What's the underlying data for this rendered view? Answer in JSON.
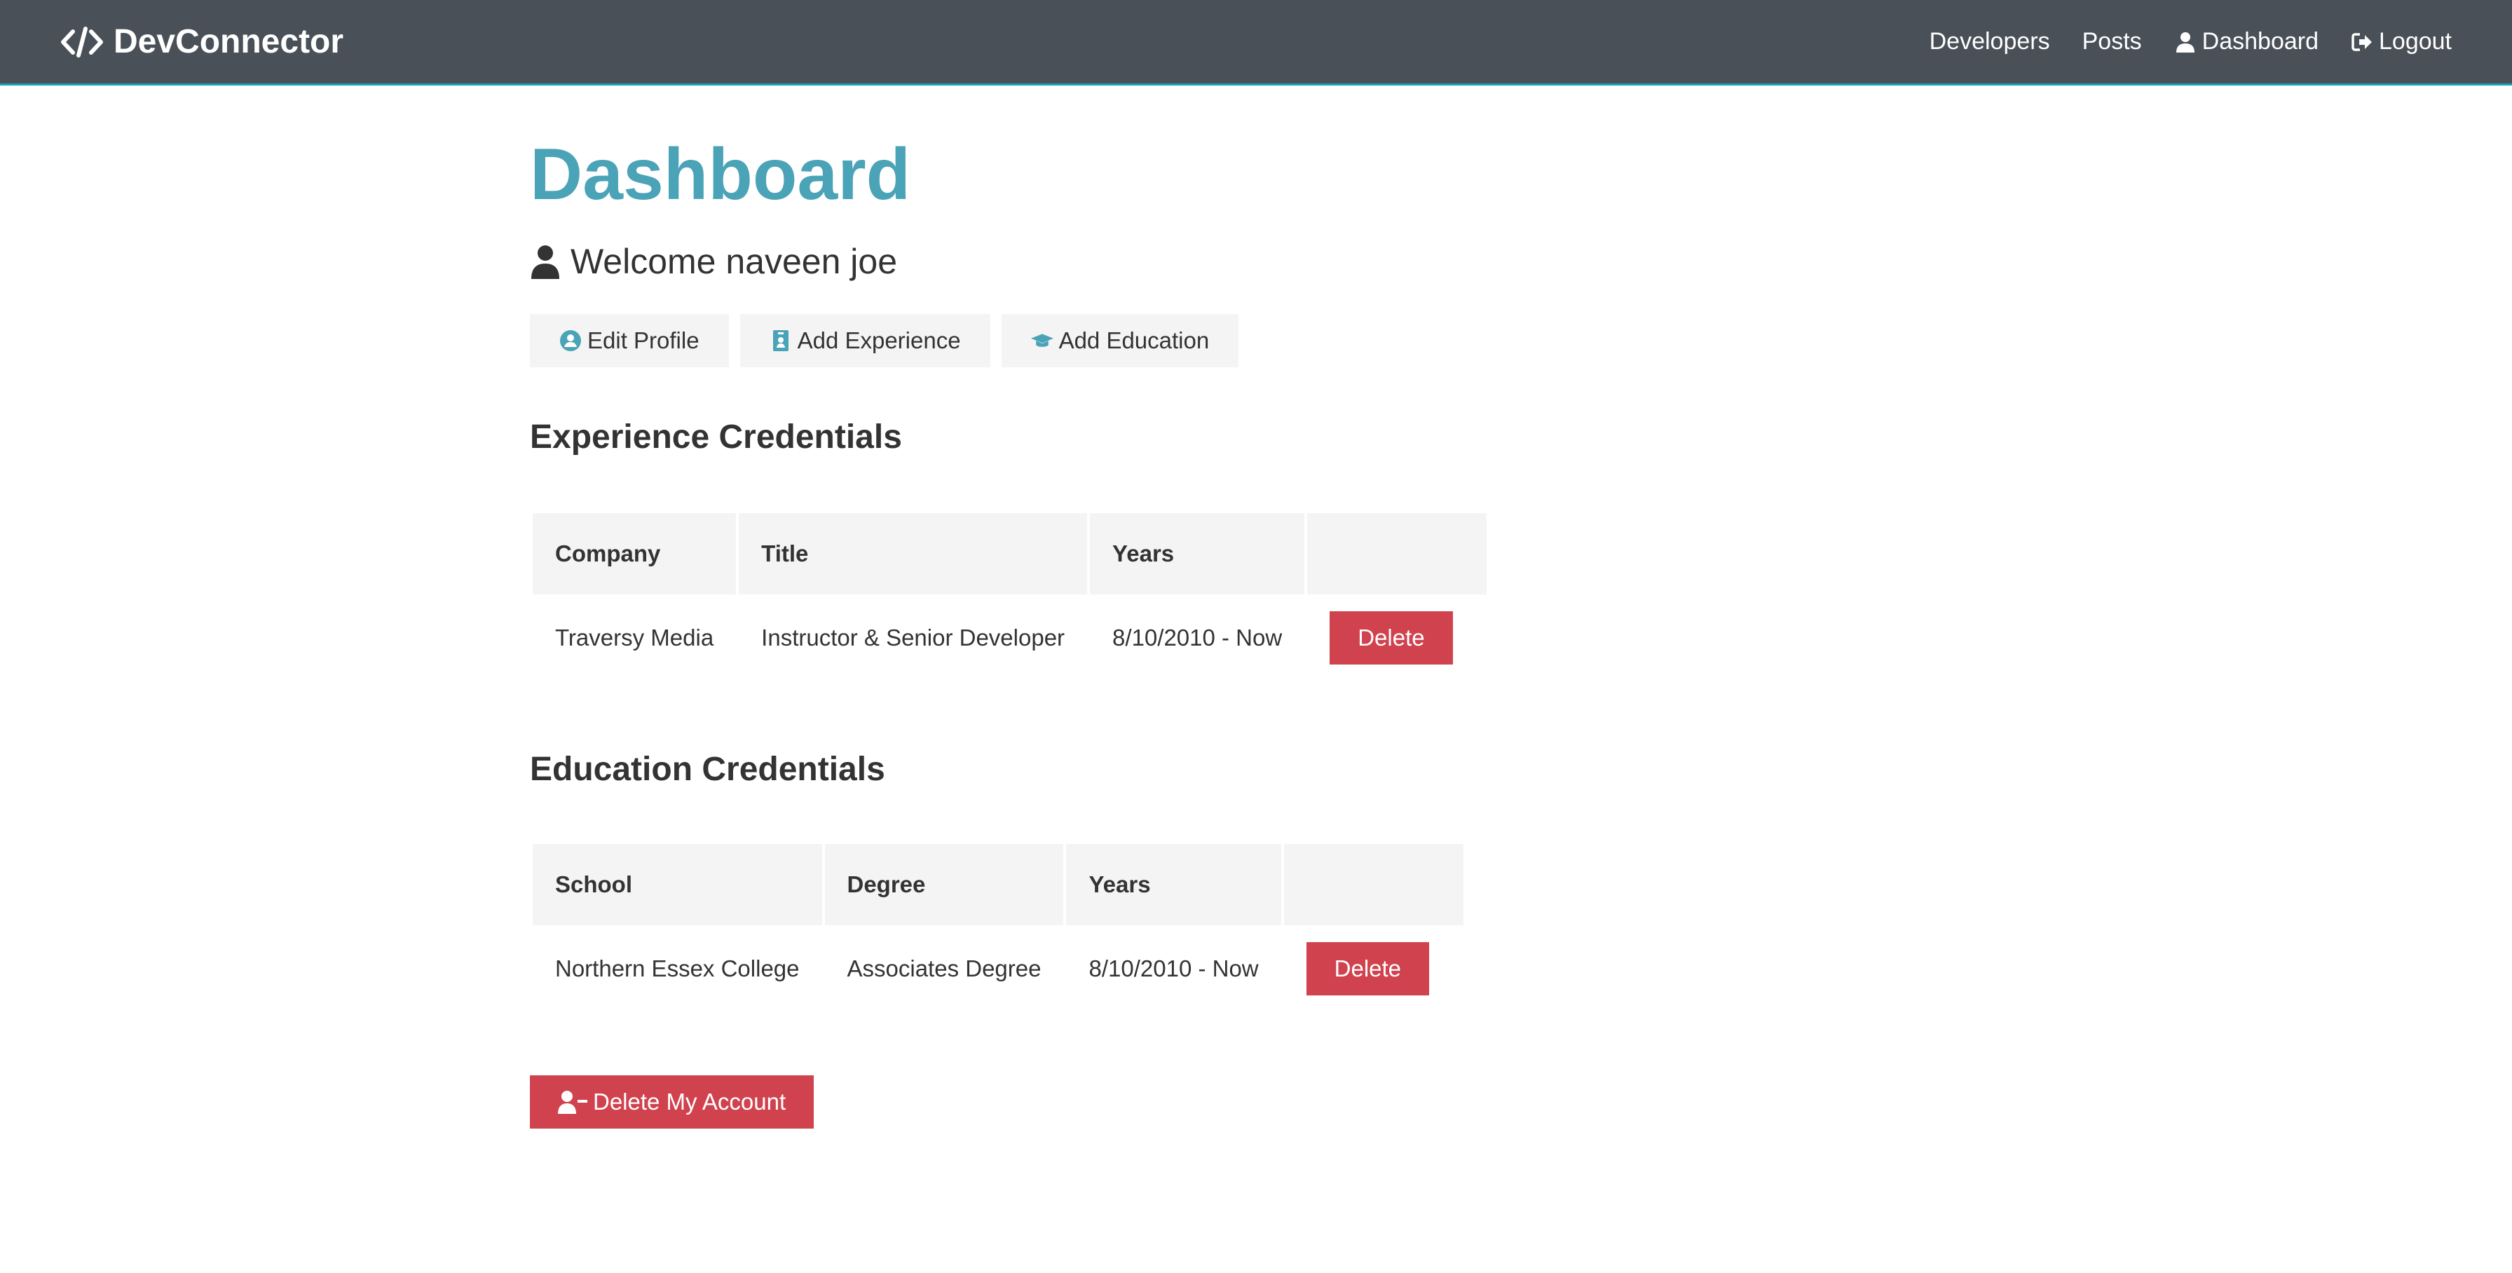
{
  "navbar": {
    "brand": "DevConnector",
    "links": {
      "developers": "Developers",
      "posts": "Posts",
      "dashboard": "Dashboard",
      "logout": "Logout"
    }
  },
  "page": {
    "title": "Dashboard",
    "welcome": "Welcome naveen joe"
  },
  "actions": {
    "edit_profile": "Edit Profile",
    "add_experience": "Add Experience",
    "add_education": "Add Education"
  },
  "experience": {
    "heading": "Experience Credentials",
    "columns": [
      "Company",
      "Title",
      "Years",
      ""
    ],
    "rows": [
      {
        "company": "Traversy Media",
        "title": "Instructor & Senior Developer",
        "years": "8/10/2010 - Now",
        "action": "Delete"
      }
    ]
  },
  "education": {
    "heading": "Education Credentials",
    "columns": [
      "School",
      "Degree",
      "Years",
      ""
    ],
    "rows": [
      {
        "school": "Northern Essex College",
        "degree": "Associates Degree",
        "years": "8/10/2010 - Now",
        "action": "Delete"
      }
    ]
  },
  "delete_account": "Delete My Account",
  "colors": {
    "navbar_bg": "#495057",
    "primary": "#4ba3b7",
    "danger": "#d0424e",
    "light": "#f4f4f4"
  }
}
